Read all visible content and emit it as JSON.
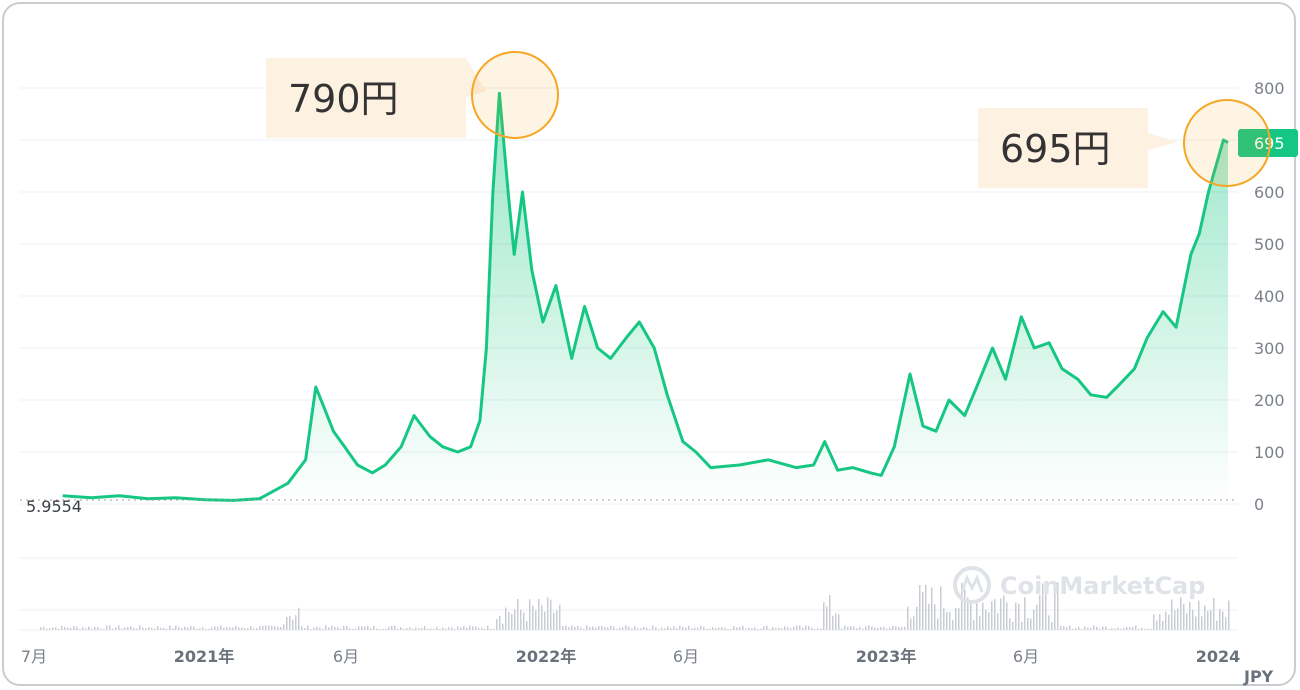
{
  "chart_data": {
    "type": "line",
    "title": "",
    "xlabel": "",
    "ylabel": "",
    "ylim": [
      0,
      900
    ],
    "y_ticks": [
      "0",
      "100",
      "200",
      "300",
      "400",
      "500",
      "600",
      "700",
      "800"
    ],
    "x_ticks": [
      {
        "label": "7月",
        "bold": false
      },
      {
        "label": "2021年",
        "bold": true
      },
      {
        "label": "6月",
        "bold": false
      },
      {
        "label": "2022年",
        "bold": true
      },
      {
        "label": "6月",
        "bold": false
      },
      {
        "label": "2023年",
        "bold": true
      },
      {
        "label": "6月",
        "bold": false
      },
      {
        "label": "2024",
        "bold": true
      }
    ],
    "unit": "JPY",
    "series": [
      {
        "color": "#16c784",
        "x": [
          "2020-08-01",
          "2020-09-01",
          "2020-10-01",
          "2020-11-01",
          "2020-12-01",
          "2021-01-01",
          "2021-02-01",
          "2021-03-01",
          "2021-04-01",
          "2021-04-20",
          "2021-05-01",
          "2021-05-10",
          "2021-05-20",
          "2021-06-01",
          "2021-06-15",
          "2021-07-01",
          "2021-07-15",
          "2021-08-01",
          "2021-08-15",
          "2021-09-01",
          "2021-09-15",
          "2021-10-01",
          "2021-10-15",
          "2021-10-25",
          "2021-11-01",
          "2021-11-08",
          "2021-11-15",
          "2021-11-25",
          "2021-12-01",
          "2021-12-10",
          "2021-12-20",
          "2022-01-01",
          "2022-01-15",
          "2022-02-01",
          "2022-02-15",
          "2022-03-01",
          "2022-03-15",
          "2022-04-01",
          "2022-04-15",
          "2022-05-01",
          "2022-05-15",
          "2022-06-01",
          "2022-06-15",
          "2022-07-01",
          "2022-08-01",
          "2022-09-01",
          "2022-10-01",
          "2022-10-20",
          "2022-11-01",
          "2022-11-15",
          "2022-12-01",
          "2022-12-20",
          "2023-01-01",
          "2023-01-15",
          "2023-02-01",
          "2023-02-15",
          "2023-03-01",
          "2023-03-15",
          "2023-04-01",
          "2023-04-15",
          "2023-05-01",
          "2023-05-15",
          "2023-06-01",
          "2023-06-15",
          "2023-07-01",
          "2023-07-15",
          "2023-08-01",
          "2023-08-15",
          "2023-09-01",
          "2023-09-15",
          "2023-10-01",
          "2023-10-15",
          "2023-11-01",
          "2023-11-15",
          "2023-12-01",
          "2023-12-10",
          "2023-12-20",
          "2023-12-28",
          "2024-01-05",
          "2024-01-10"
        ],
        "values": [
          16,
          12,
          16,
          10,
          12,
          8,
          7,
          10,
          40,
          85,
          225,
          185,
          140,
          110,
          75,
          60,
          75,
          110,
          170,
          130,
          110,
          100,
          110,
          160,
          300,
          600,
          790,
          590,
          480,
          600,
          450,
          350,
          420,
          280,
          380,
          300,
          280,
          320,
          350,
          300,
          210,
          120,
          100,
          70,
          75,
          85,
          70,
          75,
          120,
          65,
          70,
          60,
          55,
          110,
          250,
          150,
          140,
          200,
          170,
          230,
          300,
          240,
          360,
          300,
          310,
          260,
          240,
          210,
          205,
          230,
          260,
          320,
          370,
          340,
          480,
          520,
          600,
          650,
          700,
          695
        ]
      }
    ],
    "start_label": "5.9554",
    "current_price_label": "695",
    "callouts": [
      {
        "text": "790円",
        "x": "2021-11-15",
        "y": 790
      },
      {
        "text": "695円",
        "x": "2024-01-08",
        "y": 695
      }
    ]
  },
  "watermark": {
    "text": "CoinMarketCap"
  },
  "colors": {
    "line": "#16c784",
    "callout_bg": "#fdf1e2",
    "highlight_ring": "#f5a623",
    "grid": "#eceff3",
    "volume": "#c9cdd3"
  }
}
